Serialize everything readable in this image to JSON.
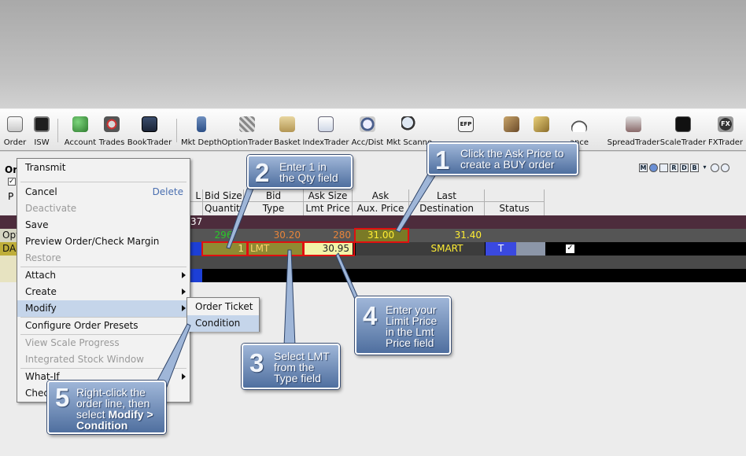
{
  "toolbar": {
    "items": [
      {
        "label": "Order",
        "icon": "order-ticket-icon"
      },
      {
        "label": "ISW",
        "icon": "monitor-icon"
      },
      {
        "label": "Account",
        "icon": "account-icon"
      },
      {
        "label": "Trades",
        "icon": "trades-icon"
      },
      {
        "label": "BookTrader",
        "icon": "book-icon"
      },
      {
        "label": "Mkt Depth",
        "icon": "market-depth-icon"
      },
      {
        "label": "OptionTrader",
        "icon": "option-trader-icon"
      },
      {
        "label": "Basket",
        "icon": "basket-icon"
      },
      {
        "label": "IndexTrader",
        "icon": "index-trader-icon"
      },
      {
        "label": "Acc/Dist",
        "icon": "clock-icon"
      },
      {
        "label": "Mkt Scanne",
        "icon": "magnifier-icon"
      },
      {
        "label": "EFP",
        "icon": "efp-icon"
      },
      {
        "label": "",
        "icon": "cube-icon"
      },
      {
        "label": "",
        "icon": "broom-icon"
      },
      {
        "label": "ance",
        "icon": "gauge-icon"
      },
      {
        "label": "SpreadTrader",
        "icon": "spread-trader-icon"
      },
      {
        "label": "ScaleTrader",
        "icon": "scale-trader-icon"
      },
      {
        "label": "FXTrader",
        "icon": "fx-icon"
      }
    ]
  },
  "panel": {
    "title": "Or",
    "header_letter": "P",
    "columns": [
      {
        "top": "Bid Size",
        "bottom": "Quantity"
      },
      {
        "top": "Bid",
        "bottom": "Type"
      },
      {
        "top": "Ask Size",
        "bottom": "Lmt Price"
      },
      {
        "top": "Ask",
        "bottom": "Aux. Price"
      },
      {
        "top": "Last",
        "bottom": "Destination"
      },
      {
        "top": "",
        "bottom": "Status"
      }
    ],
    "group_value": "37",
    "market_row": {
      "label": "Opt",
      "bid_size": "296",
      "bid": "30.20",
      "ask_size": "280",
      "ask": "31.00",
      "last": "31.40"
    },
    "order_row": {
      "label": "DA",
      "quantity": "1",
      "type": "LMT",
      "lmt_price": "30.95",
      "destination": "SMART",
      "status": "T",
      "checkbox": "✓"
    }
  },
  "context_menu": {
    "items": [
      {
        "label": "Transmit",
        "enabled": true
      },
      {
        "label": "Cancel",
        "shortcut": "Delete",
        "enabled": true
      },
      {
        "label": "Deactivate",
        "enabled": false
      },
      {
        "label": "Save",
        "enabled": true
      },
      {
        "label": "Preview Order/Check Margin",
        "enabled": true
      },
      {
        "label": "Restore",
        "enabled": false
      },
      {
        "label": "Attach",
        "enabled": true
      },
      {
        "label": "Create",
        "enabled": true
      },
      {
        "label": "Modify",
        "enabled": true
      },
      {
        "label": "Configure Order Presets",
        "enabled": true
      },
      {
        "label": "View Scale Progress",
        "enabled": false
      },
      {
        "label": "Integrated Stock Window",
        "enabled": false
      },
      {
        "label": "What-If",
        "enabled": true
      },
      {
        "label": "Chec",
        "enabled": true
      }
    ],
    "submenu": [
      "Order Ticket",
      "Condition"
    ]
  },
  "callouts": [
    {
      "num": "1",
      "lines": [
        "Click the Ask Price to",
        "create a BUY order"
      ]
    },
    {
      "num": "2",
      "lines": [
        "Enter 1 in",
        "the Qty field"
      ]
    },
    {
      "num": "3",
      "lines": [
        "Select LMT",
        "from the",
        "Type field"
      ]
    },
    {
      "num": "4",
      "lines": [
        "Enter your",
        "Limit Price",
        "in the Lmt",
        "Price field"
      ]
    },
    {
      "num": "5",
      "lines": [
        "Right-click the",
        "order line, then",
        "select ",
        "Modify >",
        "Condition"
      ]
    }
  ],
  "colors": {
    "callout_bg": "#6f8cb9",
    "highlight": "#e01010",
    "menu_selected": "#c5d5ea",
    "order_type_bg": "#9a9a2a",
    "status_blue": "#3a49e0"
  }
}
